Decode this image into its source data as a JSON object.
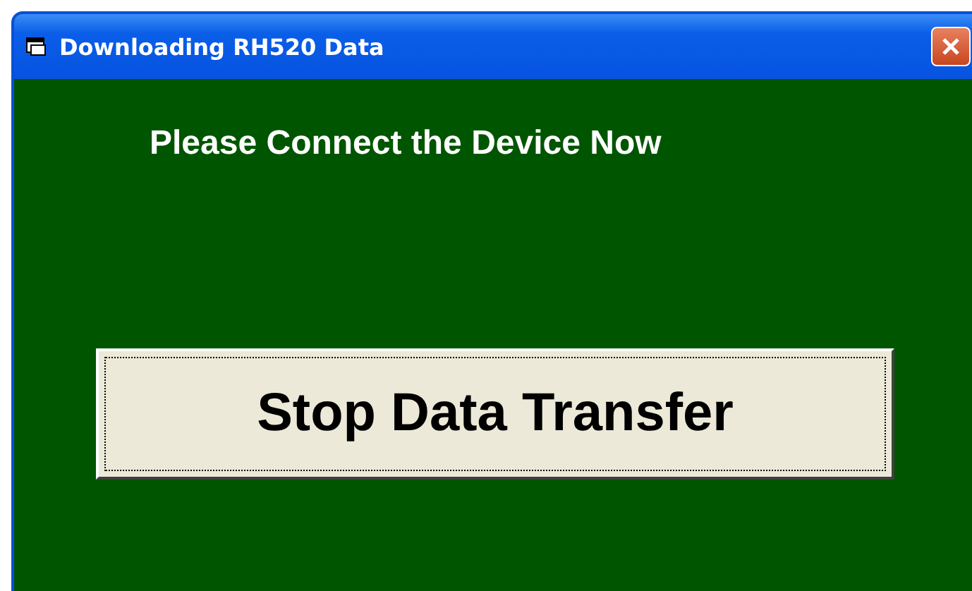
{
  "window": {
    "title": "Downloading RH520 Data"
  },
  "message": "Please Connect the Device Now",
  "button": {
    "label": "Stop Data Transfer",
    "focused": true
  }
}
